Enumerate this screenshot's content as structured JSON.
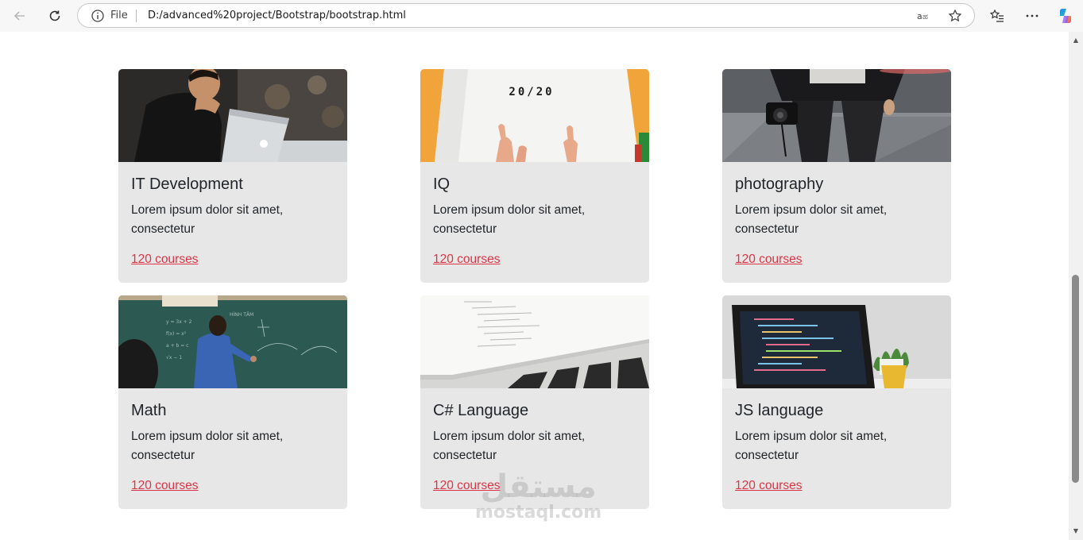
{
  "browser": {
    "address_label": "File",
    "url": "D:/advanced%20project/Bootstrap/bootstrap.html"
  },
  "cards": [
    {
      "title": "IT Development",
      "text": "Lorem ipsum dolor sit amet, consectetur",
      "link": "120 courses"
    },
    {
      "title": "IQ",
      "text": "Lorem ipsum dolor sit amet, consectetur",
      "link": "120 courses",
      "image_text": "20/20"
    },
    {
      "title": "photography",
      "text": "Lorem ipsum dolor sit amet, consectetur",
      "link": "120 courses"
    },
    {
      "title": "Math",
      "text": "Lorem ipsum dolor sit amet, consectetur",
      "link": "120 courses"
    },
    {
      "title": "C# Language",
      "text": "Lorem ipsum dolor sit amet, consectetur",
      "link": "120 courses"
    },
    {
      "title": "JS language",
      "text": "Lorem ipsum dolor sit amet, consectetur",
      "link": "120 courses"
    }
  ],
  "watermark": {
    "arabic": "مستقل",
    "latin": "mostaql.com"
  },
  "colors": {
    "link": "#dc3545",
    "card_bg": "#e7e7e7"
  }
}
